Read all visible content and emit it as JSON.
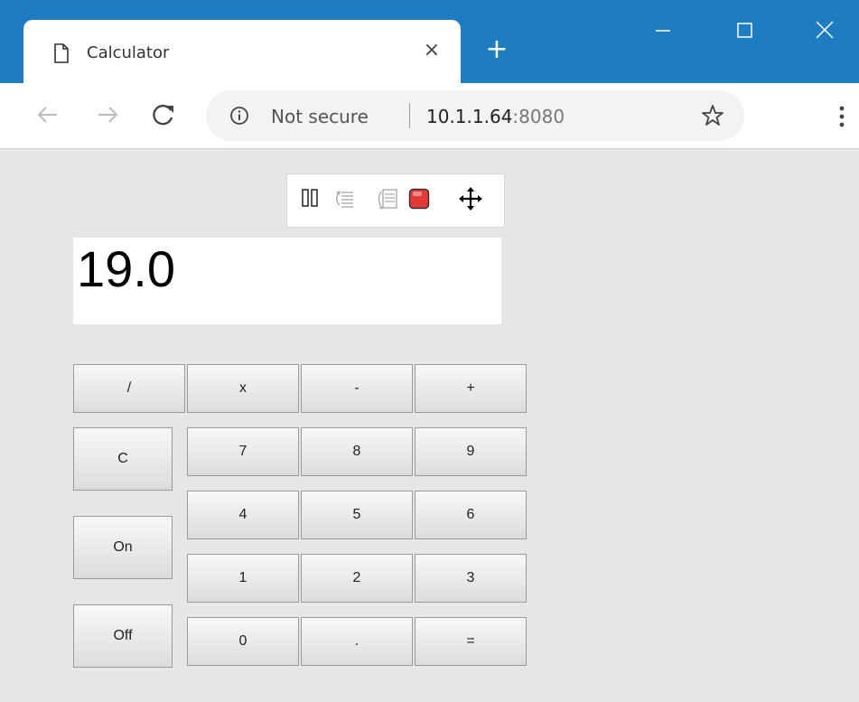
{
  "browser": {
    "tab_title": "Calculator",
    "tab_close": "×",
    "new_tab": "+",
    "security_label": "Not secure",
    "url_host": "10.1.1.64",
    "url_port": ":8080"
  },
  "debug_toolbar": {
    "icons": [
      "pause-icon",
      "step-over-icon",
      "step-into-icon",
      "stop-icon",
      "move-icon"
    ],
    "stop_color": "#e53935"
  },
  "calculator": {
    "display": "19.0",
    "buttons": {
      "divide": "/",
      "multiply": "x",
      "subtract": "-",
      "add": "+",
      "clear": "C",
      "on": "On",
      "off": "Off",
      "seven": "7",
      "eight": "8",
      "nine": "9",
      "four": "4",
      "five": "5",
      "six": "6",
      "one": "1",
      "two": "2",
      "three": "3",
      "zero": "0",
      "decimal": ".",
      "equals": "="
    }
  },
  "colors": {
    "titlebar": "#1e7dc1",
    "content_bg": "#e6e6e6"
  }
}
